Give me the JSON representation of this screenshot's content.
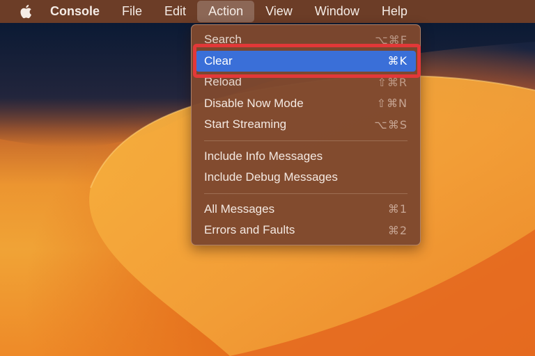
{
  "menubar": {
    "apple_icon": "apple-icon",
    "app_name": "Console",
    "menus": [
      "File",
      "Edit",
      "Action",
      "View",
      "Window",
      "Help"
    ],
    "active_menu": "Action"
  },
  "dropdown": {
    "groups": [
      [
        {
          "label": "Search",
          "shortcut": "⌥⌘F"
        },
        {
          "label": "Clear",
          "shortcut": "⌘K",
          "highlighted": true
        },
        {
          "label": "Reload",
          "shortcut": "⇧⌘R"
        },
        {
          "label": "Disable Now Mode",
          "shortcut": "⇧⌘N"
        },
        {
          "label": "Start Streaming",
          "shortcut": "⌥⌘S"
        }
      ],
      [
        {
          "label": "Include Info Messages",
          "shortcut": ""
        },
        {
          "label": "Include Debug Messages",
          "shortcut": ""
        }
      ],
      [
        {
          "label": "All Messages",
          "shortcut": "⌘1"
        },
        {
          "label": "Errors and Faults",
          "shortcut": "⌘2"
        }
      ]
    ]
  },
  "colors": {
    "menu_highlight": "#3a6fd8",
    "callout_border": "#e23838",
    "menubar_bg": "#703e26",
    "dropdown_bg": "#7e482e"
  }
}
